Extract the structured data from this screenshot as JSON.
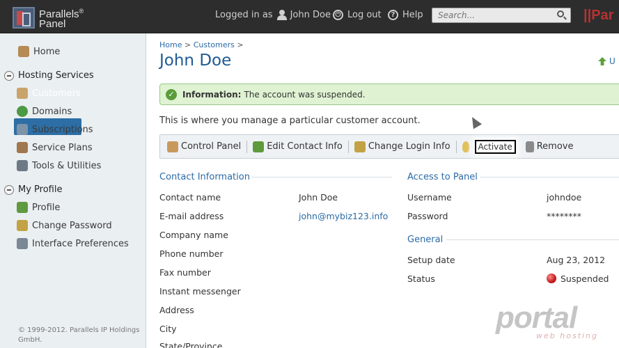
{
  "header": {
    "logo_line1": "Parallels",
    "logo_line2": "Panel",
    "logged_in_prefix": "Logged in as",
    "user_name": "John Doe",
    "logout_label": "Log out",
    "help_label": "Help",
    "search_placeholder": "Search...",
    "brand_right": "||Par"
  },
  "sidebar": {
    "home": "Home",
    "hosting_services": "Hosting Services",
    "hosting_items": [
      "Customers",
      "Domains",
      "Subscriptions",
      "Service Plans",
      "Tools & Utilities"
    ],
    "my_profile": "My Profile",
    "profile_items": [
      "Profile",
      "Change Password",
      "Interface Preferences"
    ],
    "footer": "© 1999-2012. Parallels IP Holdings GmbH."
  },
  "main": {
    "breadcrumb_home": "Home",
    "breadcrumb_customers": "Customers",
    "breadcrumb_sep": ">",
    "title": "John Doe",
    "upgrade_label": "U",
    "message_label": "Information:",
    "message_text": "The account was suspended.",
    "hint": "This is where you manage a particular customer account.",
    "toolbar": {
      "control_panel": "Control Panel",
      "edit_contact": "Edit Contact Info",
      "change_login": "Change Login Info",
      "activate": "Activate",
      "remove": "Remove"
    },
    "contact": {
      "title": "Contact Information",
      "rows": [
        {
          "label": "Contact name",
          "value": "John Doe"
        },
        {
          "label": "E-mail address",
          "value": "john@mybiz123.info"
        },
        {
          "label": "Company name",
          "value": ""
        },
        {
          "label": "Phone number",
          "value": ""
        },
        {
          "label": "Fax number",
          "value": ""
        },
        {
          "label": "Instant messenger",
          "value": ""
        },
        {
          "label": "Address",
          "value": ""
        },
        {
          "label": "City",
          "value": ""
        },
        {
          "label": "State/Province",
          "value": ""
        }
      ]
    },
    "access": {
      "title": "Access to Panel",
      "username_label": "Username",
      "username_value": "johndoe",
      "password_label": "Password",
      "password_value": "********"
    },
    "general": {
      "title": "General",
      "setup_label": "Setup date",
      "setup_value": "Aug 23, 2012",
      "status_label": "Status",
      "status_value": "Suspended"
    }
  },
  "watermark": {
    "text": "portal",
    "sub": "web hosting"
  },
  "colors": {
    "accent": "#2b6aa6",
    "active_nav": "#2c6ea5",
    "header_bg": "#2d2d2d",
    "success_bg": "#dff2d2",
    "status_red": "#c21c1c"
  }
}
